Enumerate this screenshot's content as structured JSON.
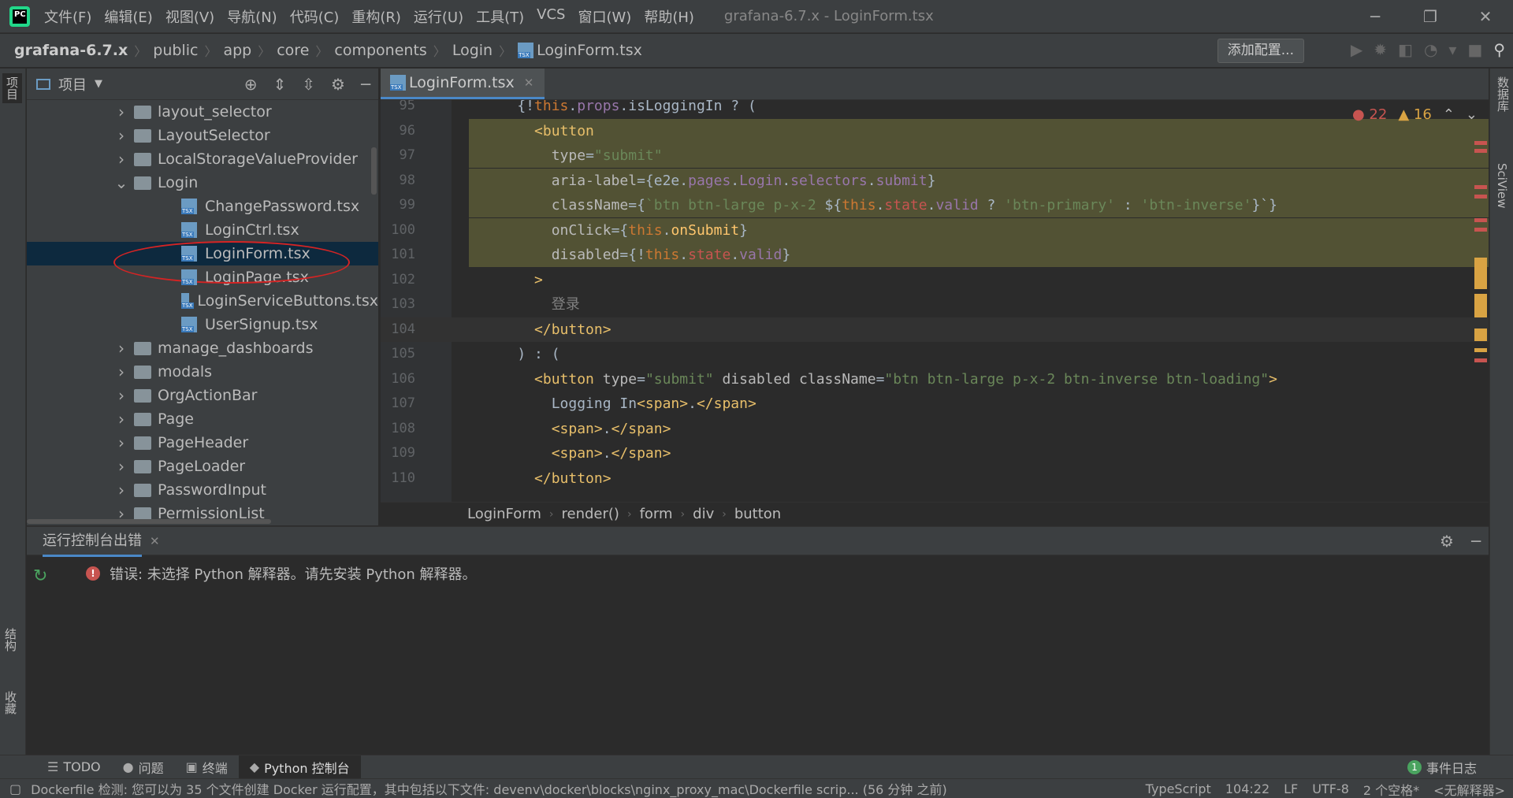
{
  "menu": [
    "文件(F)",
    "编辑(E)",
    "视图(V)",
    "导航(N)",
    "代码(C)",
    "重构(R)",
    "运行(U)",
    "工具(T)",
    "VCS",
    "窗口(W)",
    "帮助(H)"
  ],
  "window_title": "grafana-6.7.x - LoginForm.tsx",
  "breadcrumb": [
    "grafana-6.7.x",
    "public",
    "app",
    "core",
    "components",
    "Login",
    "LoginForm.tsx"
  ],
  "add_config": "添加配置...",
  "left_tabs": {
    "project": "项目",
    "structure": "结构",
    "favorites": "收藏"
  },
  "right_tabs": {
    "database": "数据库",
    "sciview": "SciView"
  },
  "project_panel": {
    "title": "项目"
  },
  "tree": [
    {
      "label": "layout_selector",
      "type": "folder",
      "open": false
    },
    {
      "label": "LayoutSelector",
      "type": "folder",
      "open": false
    },
    {
      "label": "LocalStorageValueProvider",
      "type": "folder",
      "open": false
    },
    {
      "label": "Login",
      "type": "folder",
      "open": true
    },
    {
      "label": "ChangePassword.tsx",
      "type": "file"
    },
    {
      "label": "LoginCtrl.tsx",
      "type": "file"
    },
    {
      "label": "LoginForm.tsx",
      "type": "file",
      "selected": true
    },
    {
      "label": "LoginPage.tsx",
      "type": "file"
    },
    {
      "label": "LoginServiceButtons.tsx",
      "type": "file"
    },
    {
      "label": "UserSignup.tsx",
      "type": "file"
    },
    {
      "label": "manage_dashboards",
      "type": "folder",
      "open": false
    },
    {
      "label": "modals",
      "type": "folder",
      "open": false
    },
    {
      "label": "OrgActionBar",
      "type": "folder",
      "open": false
    },
    {
      "label": "Page",
      "type": "folder",
      "open": false
    },
    {
      "label": "PageHeader",
      "type": "folder",
      "open": false
    },
    {
      "label": "PageLoader",
      "type": "folder",
      "open": false
    },
    {
      "label": "PasswordInput",
      "type": "folder",
      "open": false
    },
    {
      "label": "PermissionList",
      "type": "folder",
      "open": false
    }
  ],
  "editor_tab": "LoginForm.tsx",
  "inspections": {
    "errors": "22",
    "warnings": "16"
  },
  "code_lines": [
    {
      "n": "95",
      "segs": [
        [
          "    {!",
          ""
        ],
        [
          "this",
          "kw"
        ],
        [
          ".",
          ""
        ],
        [
          "props",
          "pr"
        ],
        [
          ".isLoggingIn ? (",
          ""
        ]
      ]
    },
    {
      "n": "96",
      "segs": [
        [
          "      ",
          ""
        ],
        [
          "<button",
          "tag"
        ]
      ],
      "hl": true
    },
    {
      "n": "97",
      "segs": [
        [
          "        ",
          ""
        ],
        [
          "type",
          "attr"
        ],
        [
          "=",
          ""
        ],
        [
          "\"submit\"",
          "str"
        ]
      ],
      "hl": true
    },
    {
      "n": "98",
      "segs": [
        [
          "        ",
          ""
        ],
        [
          "aria-label",
          "attr"
        ],
        [
          "={e2e.",
          ""
        ],
        [
          "pages",
          "pr"
        ],
        [
          ".",
          ""
        ],
        [
          "Login",
          "pr"
        ],
        [
          ".",
          ""
        ],
        [
          "selectors",
          "pr"
        ],
        [
          ".",
          ""
        ],
        [
          "submit",
          "pr"
        ],
        [
          "}",
          ""
        ]
      ],
      "hl": true
    },
    {
      "n": "99",
      "segs": [
        [
          "        ",
          ""
        ],
        [
          "className",
          "attr"
        ],
        [
          "={",
          ""
        ],
        [
          "`btn btn-large p-x-2 ",
          "str"
        ],
        [
          "${",
          ""
        ],
        [
          "this",
          "kw"
        ],
        [
          ".",
          ""
        ],
        [
          "state",
          "red"
        ],
        [
          ".",
          ""
        ],
        [
          "valid",
          "pr"
        ],
        [
          " ? ",
          ""
        ],
        [
          "'btn-primary'",
          "str"
        ],
        [
          " : ",
          ""
        ],
        [
          "'btn-inverse'",
          "str"
        ],
        [
          "}`}",
          ""
        ]
      ],
      "hl": true
    },
    {
      "n": "100",
      "segs": [
        [
          "        ",
          ""
        ],
        [
          "onClick",
          "attr"
        ],
        [
          "={",
          ""
        ],
        [
          "this",
          "kw"
        ],
        [
          ".",
          ""
        ],
        [
          "onSubmit",
          "fn"
        ],
        [
          "}",
          ""
        ]
      ],
      "hl": true
    },
    {
      "n": "101",
      "segs": [
        [
          "        ",
          ""
        ],
        [
          "disabled",
          "attr"
        ],
        [
          "={!",
          ""
        ],
        [
          "this",
          "kw"
        ],
        [
          ".",
          ""
        ],
        [
          "state",
          "red"
        ],
        [
          ".",
          ""
        ],
        [
          "valid",
          "pr"
        ],
        [
          "}",
          ""
        ]
      ],
      "hl": true
    },
    {
      "n": "102",
      "segs": [
        [
          "      ",
          ""
        ],
        [
          ">",
          "tag"
        ]
      ]
    },
    {
      "n": "103",
      "segs": [
        [
          "        ",
          ""
        ],
        [
          "登录",
          "grey"
        ]
      ]
    },
    {
      "n": "104",
      "segs": [
        [
          "      ",
          ""
        ],
        [
          "</button>",
          "tag"
        ]
      ],
      "cur": true
    },
    {
      "n": "105",
      "segs": [
        [
          "    ) : (",
          ""
        ]
      ]
    },
    {
      "n": "106",
      "segs": [
        [
          "      ",
          ""
        ],
        [
          "<button ",
          "tag"
        ],
        [
          "type",
          "attr"
        ],
        [
          "=",
          ""
        ],
        [
          "\"submit\" ",
          "str"
        ],
        [
          "disabled ",
          "attr"
        ],
        [
          "className",
          "attr"
        ],
        [
          "=",
          ""
        ],
        [
          "\"btn btn-large p-x-2 btn-inverse btn-loading\"",
          "str"
        ],
        [
          ">",
          "tag"
        ]
      ]
    },
    {
      "n": "107",
      "segs": [
        [
          "        Logging In",
          ""
        ],
        [
          "<span>",
          "tag"
        ],
        [
          ".",
          ""
        ],
        [
          "</span>",
          "tag"
        ]
      ]
    },
    {
      "n": "108",
      "segs": [
        [
          "        ",
          ""
        ],
        [
          "<span>",
          "tag"
        ],
        [
          ".",
          ""
        ],
        [
          "</span>",
          "tag"
        ]
      ]
    },
    {
      "n": "109",
      "segs": [
        [
          "        ",
          ""
        ],
        [
          "<span>",
          "tag"
        ],
        [
          ".",
          ""
        ],
        [
          "</span>",
          "tag"
        ]
      ]
    },
    {
      "n": "110",
      "segs": [
        [
          "      ",
          ""
        ],
        [
          "</button>",
          "tag"
        ]
      ]
    }
  ],
  "editor_breadcrumb": [
    "LoginForm",
    "render()",
    "form",
    "div",
    "button"
  ],
  "console": {
    "tab": "运行控制台出错",
    "error": "错误: 未选择 Python 解释器。请先安装 Python 解释器。"
  },
  "tool_windows": [
    {
      "label": "TODO",
      "icon": "☰"
    },
    {
      "label": "问题",
      "icon": "●"
    },
    {
      "label": "终端",
      "icon": "▣"
    },
    {
      "label": "Python 控制台",
      "icon": "◆",
      "active": true
    }
  ],
  "event_log": {
    "count": "1",
    "label": "事件日志"
  },
  "status": {
    "message": "Dockerfile 检测: 您可以为 35 个文件创建 Docker 运行配置，其中包括以下文件: devenv\\docker\\blocks\\nginx_proxy_mac\\Dockerfile scrip... (56 分钟 之前)",
    "lang": "TypeScript",
    "pos": "104:22",
    "eol": "LF",
    "enc": "UTF-8",
    "indent": "2 个空格*",
    "interp": "<无解释器>"
  },
  "colors": {
    "accent": "#4a88c7",
    "error": "#c75450",
    "warning": "#d9a343",
    "highlight": "#525234"
  }
}
